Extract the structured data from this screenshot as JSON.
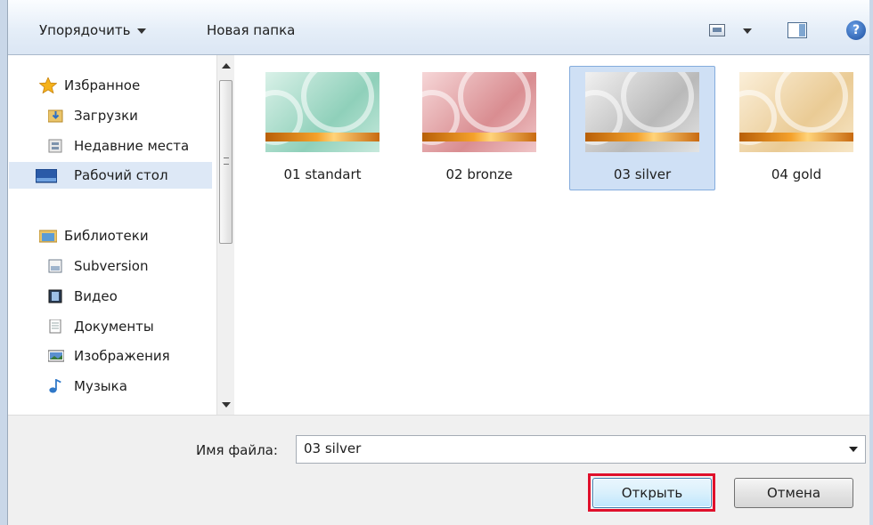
{
  "toolbar": {
    "organize_label": "Упорядочить",
    "new_folder_label": "Новая папка"
  },
  "nav": {
    "items": [
      {
        "label": "Избранное",
        "icon": "star-icon",
        "header": true
      },
      {
        "label": "Загрузки",
        "icon": "downloads-folder-icon"
      },
      {
        "label": "Недавние места",
        "icon": "recent-places-icon"
      },
      {
        "label": "Рабочий стол",
        "icon": "desktop-icon",
        "selected": true
      },
      {
        "label": "Библиотеки",
        "icon": "libraries-icon",
        "header": true
      },
      {
        "label": "Subversion",
        "icon": "library-icon"
      },
      {
        "label": "Видео",
        "icon": "video-library-icon"
      },
      {
        "label": "Документы",
        "icon": "documents-library-icon"
      },
      {
        "label": "Изображения",
        "icon": "pictures-library-icon"
      },
      {
        "label": "Музыка",
        "icon": "music-library-icon"
      }
    ]
  },
  "files": [
    {
      "name": "01 standart",
      "color": "#a9dccb"
    },
    {
      "name": "02 bronze",
      "color": "#e8aeb0"
    },
    {
      "name": "03 silver",
      "color": "#d4d4d4",
      "selected": true
    },
    {
      "name": "04 gold",
      "color": "#f3e0be"
    }
  ],
  "bottom": {
    "filename_label": "Имя файла:",
    "filename_value": "03 silver",
    "open_label": "Открыть",
    "cancel_label": "Отмена",
    "highlight_color": "#e0102b"
  }
}
